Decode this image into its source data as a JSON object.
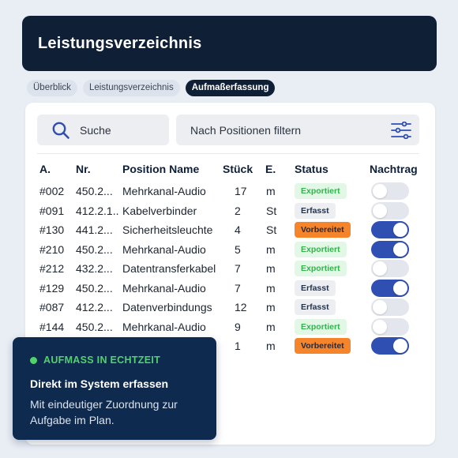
{
  "header": {
    "title": "Leistungsverzeichnis"
  },
  "tabs": [
    {
      "label": "Überblick",
      "active": false
    },
    {
      "label": "Leistungsverzeichnis",
      "active": false
    },
    {
      "label": "Aufmaßerfassung",
      "active": true
    }
  ],
  "search": {
    "label": "Suche",
    "icon": "search-icon"
  },
  "filter": {
    "label": "Nach Positionen filtern",
    "icon": "sliders-icon"
  },
  "table": {
    "headers": {
      "a": "A.",
      "nr": "Nr.",
      "name": "Position Name",
      "stueck": "Stück",
      "e": "E.",
      "status": "Status",
      "nachtrag": "Nachtrag"
    },
    "rows": [
      {
        "a": "#002",
        "nr": "450.2...",
        "name": "Mehrkanal-Audio",
        "stueck": "17",
        "e": "m",
        "status": "Exportiert",
        "nachtrag": false
      },
      {
        "a": "#091",
        "nr": "412.2.1..",
        "name": "Kabelverbinder",
        "stueck": "2",
        "e": "St",
        "status": "Erfasst",
        "nachtrag": false
      },
      {
        "a": "#130",
        "nr": "441.2...",
        "name": "Sicherheitsleuchte",
        "stueck": "4",
        "e": "St",
        "status": "Vorbereitet",
        "nachtrag": true
      },
      {
        "a": "#210",
        "nr": "450.2...",
        "name": "Mehrkanal-Audio",
        "stueck": "5",
        "e": "m",
        "status": "Exportiert",
        "nachtrag": true
      },
      {
        "a": "#212",
        "nr": "432.2...",
        "name": "Datentransferkabel",
        "stueck": "7",
        "e": "m",
        "status": "Exportiert",
        "nachtrag": false
      },
      {
        "a": "#129",
        "nr": "450.2...",
        "name": "Mehrkanal-Audio",
        "stueck": "7",
        "e": "m",
        "status": "Erfasst",
        "nachtrag": true
      },
      {
        "a": "#087",
        "nr": "412.2...",
        "name": "Datenverbindungs",
        "stueck": "12",
        "e": "m",
        "status": "Erfasst",
        "nachtrag": false
      },
      {
        "a": "#144",
        "nr": "450.2...",
        "name": "Mehrkanal-Audio",
        "stueck": "9",
        "e": "m",
        "status": "Exportiert",
        "nachtrag": false
      },
      {
        "a": "",
        "nr": "",
        "name": "",
        "stueck": "1",
        "e": "m",
        "status": "Vorbereitet",
        "nachtrag": true
      }
    ]
  },
  "callout": {
    "kicker": "AUFMASS IN ECHTZEIT",
    "title": "Direkt im System erfassen",
    "body": "Mit eindeutiger Zuordnung zur Aufgabe im Plan."
  },
  "colors": {
    "navy": "#0f1f36",
    "toggle_on": "#2f4fb3",
    "exported": "#2fb54a",
    "prepared": "#f5842a",
    "accent_green": "#4fd36a"
  }
}
